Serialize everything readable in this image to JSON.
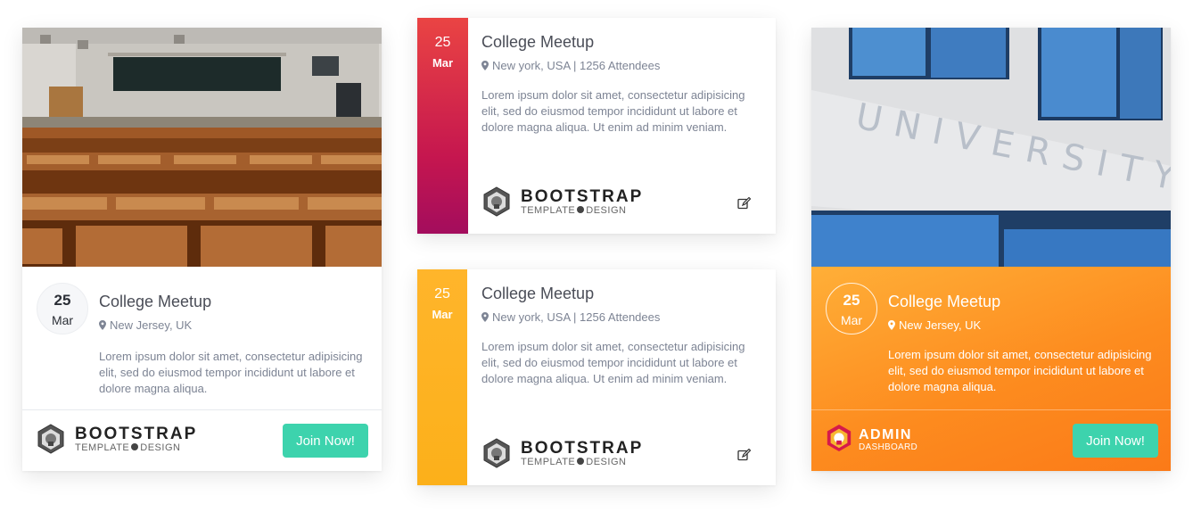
{
  "cards": [
    {
      "day": "25",
      "month": "Mar",
      "title": "College Meetup",
      "location": "New Jersey, UK",
      "description": "Lorem ipsum dolor sit amet, consectetur adipisicing elit, sed do eiusmod tempor incididunt ut labore et dolore magna aliqua.",
      "brand": {
        "name": "BOOTSTRAP",
        "sub_left": "TEMPLATE",
        "sub_right": "DESIGN"
      },
      "button": "Join Now!"
    },
    {
      "day": "25",
      "month": "Mar",
      "title": "College Meetup",
      "location": "New york, USA | 1256 Attendees",
      "description": "Lorem ipsum dolor sit amet, consectetur adipisicing elit, sed do eiusmod tempor incididunt ut labore et dolore magna aliqua. Ut enim ad minim veniam.",
      "brand": {
        "name": "BOOTSTRAP",
        "sub_left": "TEMPLATE",
        "sub_right": "DESIGN"
      },
      "accent": [
        "#ea4443",
        "#a30d5d"
      ]
    },
    {
      "day": "25",
      "month": "Mar",
      "title": "College Meetup",
      "location": "New york, USA | 1256 Attendees",
      "description": "Lorem ipsum dolor sit amet, consectetur adipisicing elit, sed do eiusmod tempor incididunt ut labore et dolore magna aliqua. Ut enim ad minim veniam.",
      "brand": {
        "name": "BOOTSTRAP",
        "sub_left": "TEMPLATE",
        "sub_right": "DESIGN"
      },
      "accent": [
        "#ffb52b",
        "#fcb01a"
      ]
    },
    {
      "day": "25",
      "month": "Mar",
      "title": "College Meetup",
      "location": "New Jersey, UK",
      "description": "Lorem ipsum dolor sit amet, consectetur adipisicing elit, sed do eiusmod tempor incididunt ut labore et dolore magna aliqua.",
      "brand": {
        "name": "ADMIN",
        "sub": "DASHBOARD"
      },
      "button": "Join Now!",
      "photo_sign": "UNIVERSITY",
      "accent": [
        "#ffaf38",
        "#fb7a18"
      ]
    }
  ],
  "colors": {
    "join_button": "#3dd3ad"
  },
  "icons": {
    "location": "map-pin-icon",
    "edit": "edit-icon",
    "logo": "lion-logo-icon"
  }
}
